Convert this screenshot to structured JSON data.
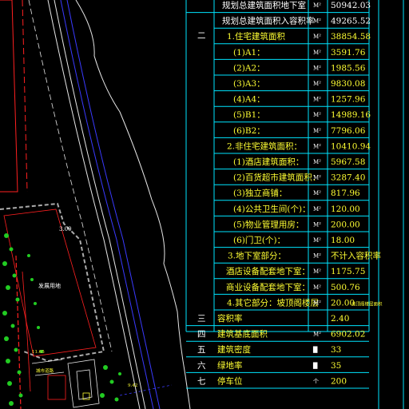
{
  "colors": {
    "background": "#000000",
    "table_line": "#00e5ff",
    "text_yellow": "#ffff33",
    "text_white": "#ffffff",
    "boundary_red": "#ff2020",
    "road_white": "#e6e6e6",
    "road_blue": "#3a3aff",
    "tree_green": "#22cc22"
  },
  "table": {
    "rows": [
      {
        "index": "",
        "label": "规划总建筑面积地下室",
        "unit": "M²",
        "value": "50942.03"
      },
      {
        "index": "",
        "label": "规划总建筑面积入容积率",
        "unit": "M²",
        "value": "49265.52"
      },
      {
        "index": "二",
        "label": "1.住宅建筑面积",
        "unit": "M²",
        "value": "38854.58"
      },
      {
        "index": "",
        "label": "(1)A1：",
        "unit": "M²",
        "value": "3591.76"
      },
      {
        "index": "",
        "label": "(2)A2：",
        "unit": "M²",
        "value": "1985.56"
      },
      {
        "index": "",
        "label": "(3)A3：",
        "unit": "M²",
        "value": "9830.08"
      },
      {
        "index": "",
        "label": "(4)A4：",
        "unit": "M²",
        "value": "1257.96"
      },
      {
        "index": "",
        "label": "(5)B1：",
        "unit": "M²",
        "value": "14989.16"
      },
      {
        "index": "",
        "label": "(6)B2：",
        "unit": "M²",
        "value": "7796.06"
      },
      {
        "index": "",
        "label": "2.非住宅建筑面积：",
        "unit": "M²",
        "value": "10410.94"
      },
      {
        "index": "",
        "label": "(1)酒店建筑面积：",
        "unit": "M²",
        "value": "5967.58"
      },
      {
        "index": "",
        "label": "(2)百货超市建筑面积：",
        "unit": "M²",
        "value": "3287.40"
      },
      {
        "index": "",
        "label": "(3)独立商铺：",
        "unit": "M²",
        "value": "817.96"
      },
      {
        "index": "",
        "label": "(4)公共卫生间(个)：",
        "unit": "M²",
        "value": "120.00"
      },
      {
        "index": "",
        "label": "(5)物业管理用房：",
        "unit": "M²",
        "value": "200.00"
      },
      {
        "index": "",
        "label": "(6)门卫(个)：",
        "unit": "M²",
        "value": "18.00"
      },
      {
        "index": "",
        "label": "3.地下室部分：",
        "unit": "M²",
        "value": "不计入容积率"
      },
      {
        "index": "",
        "label": "酒店设备配套地下室：",
        "unit": "M²",
        "value": "1175.75"
      },
      {
        "index": "",
        "label": "商业设备配套地下室：",
        "unit": "M²",
        "value": "500.76"
      },
      {
        "index": "",
        "label": "4.其它部分：坡顶阁楼层",
        "unit": "M²",
        "value": "20.00"
      },
      {
        "index": "三",
        "label": "容积率",
        "unit": "",
        "value": "2.40"
      },
      {
        "index": "四",
        "label": "建筑基底面积",
        "unit": "M²",
        "value": "6902.02"
      },
      {
        "index": "五",
        "label": "建筑密度",
        "unit": "█",
        "value": "33"
      },
      {
        "index": "六",
        "label": "绿地率",
        "unit": "█",
        "value": "35"
      },
      {
        "index": "七",
        "label": "停车位",
        "unit": "个",
        "value": "200"
      }
    ],
    "section_index_two": "二",
    "note_row_20": "坡顶阁楼层面积"
  },
  "site": {
    "reserved_land_label": "发展用地",
    "dim_300": "3.00",
    "dim_1165": "11.65",
    "road_label": "城市道路",
    "dim_bottom": "9.42"
  }
}
